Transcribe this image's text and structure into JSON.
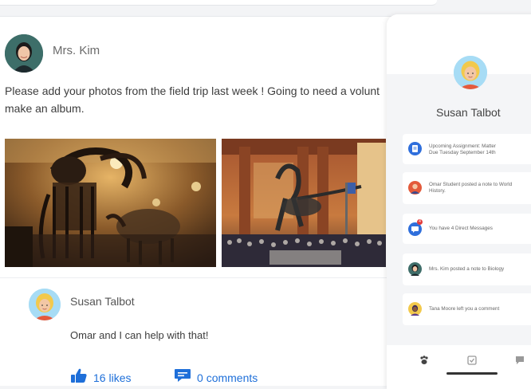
{
  "post": {
    "author": "Mrs. Kim",
    "text": "Please add your photos from the field trip last week ! Going to need a volunt make an album.",
    "photos": [
      {
        "name": "mammoth-skeleton-photo"
      },
      {
        "name": "museum-hall-photo"
      }
    ]
  },
  "reply": {
    "author": "Susan Talbot",
    "text": "Omar and I can help with that!",
    "likes_count": "16",
    "likes_label": "likes",
    "comments_count": "0",
    "comments_label": "comments"
  },
  "phone": {
    "profile_name": "Susan Talbot",
    "notifications": [
      {
        "line1": "Upcoming Assignment: Matter",
        "line2": "Due Tuesday September 14th",
        "icon": "assignment-icon",
        "color": "#2f6fdc"
      },
      {
        "line1": "Omar Student posted a note to World",
        "line2": "History.",
        "icon": "student-avatar",
        "color": "#e35a3a"
      },
      {
        "line1": "You have 4 Direct Messages",
        "line2": "",
        "icon": "message-icon",
        "color": "#2f6fdc",
        "badge": "4"
      },
      {
        "line1": "Mrs. Kim posted a note to Biology",
        "line2": "",
        "icon": "teacher-avatar",
        "color": "#3f6e6a"
      },
      {
        "line1": "Tana Moore left you a comment",
        "line2": "",
        "icon": "student-avatar",
        "color": "#5b3b8c"
      }
    ],
    "tabs": [
      "paw-icon",
      "checklist-icon",
      "chat-icon"
    ]
  },
  "colors": {
    "accent": "#1e6fd9",
    "panel_bg": "#f4f5f7"
  }
}
